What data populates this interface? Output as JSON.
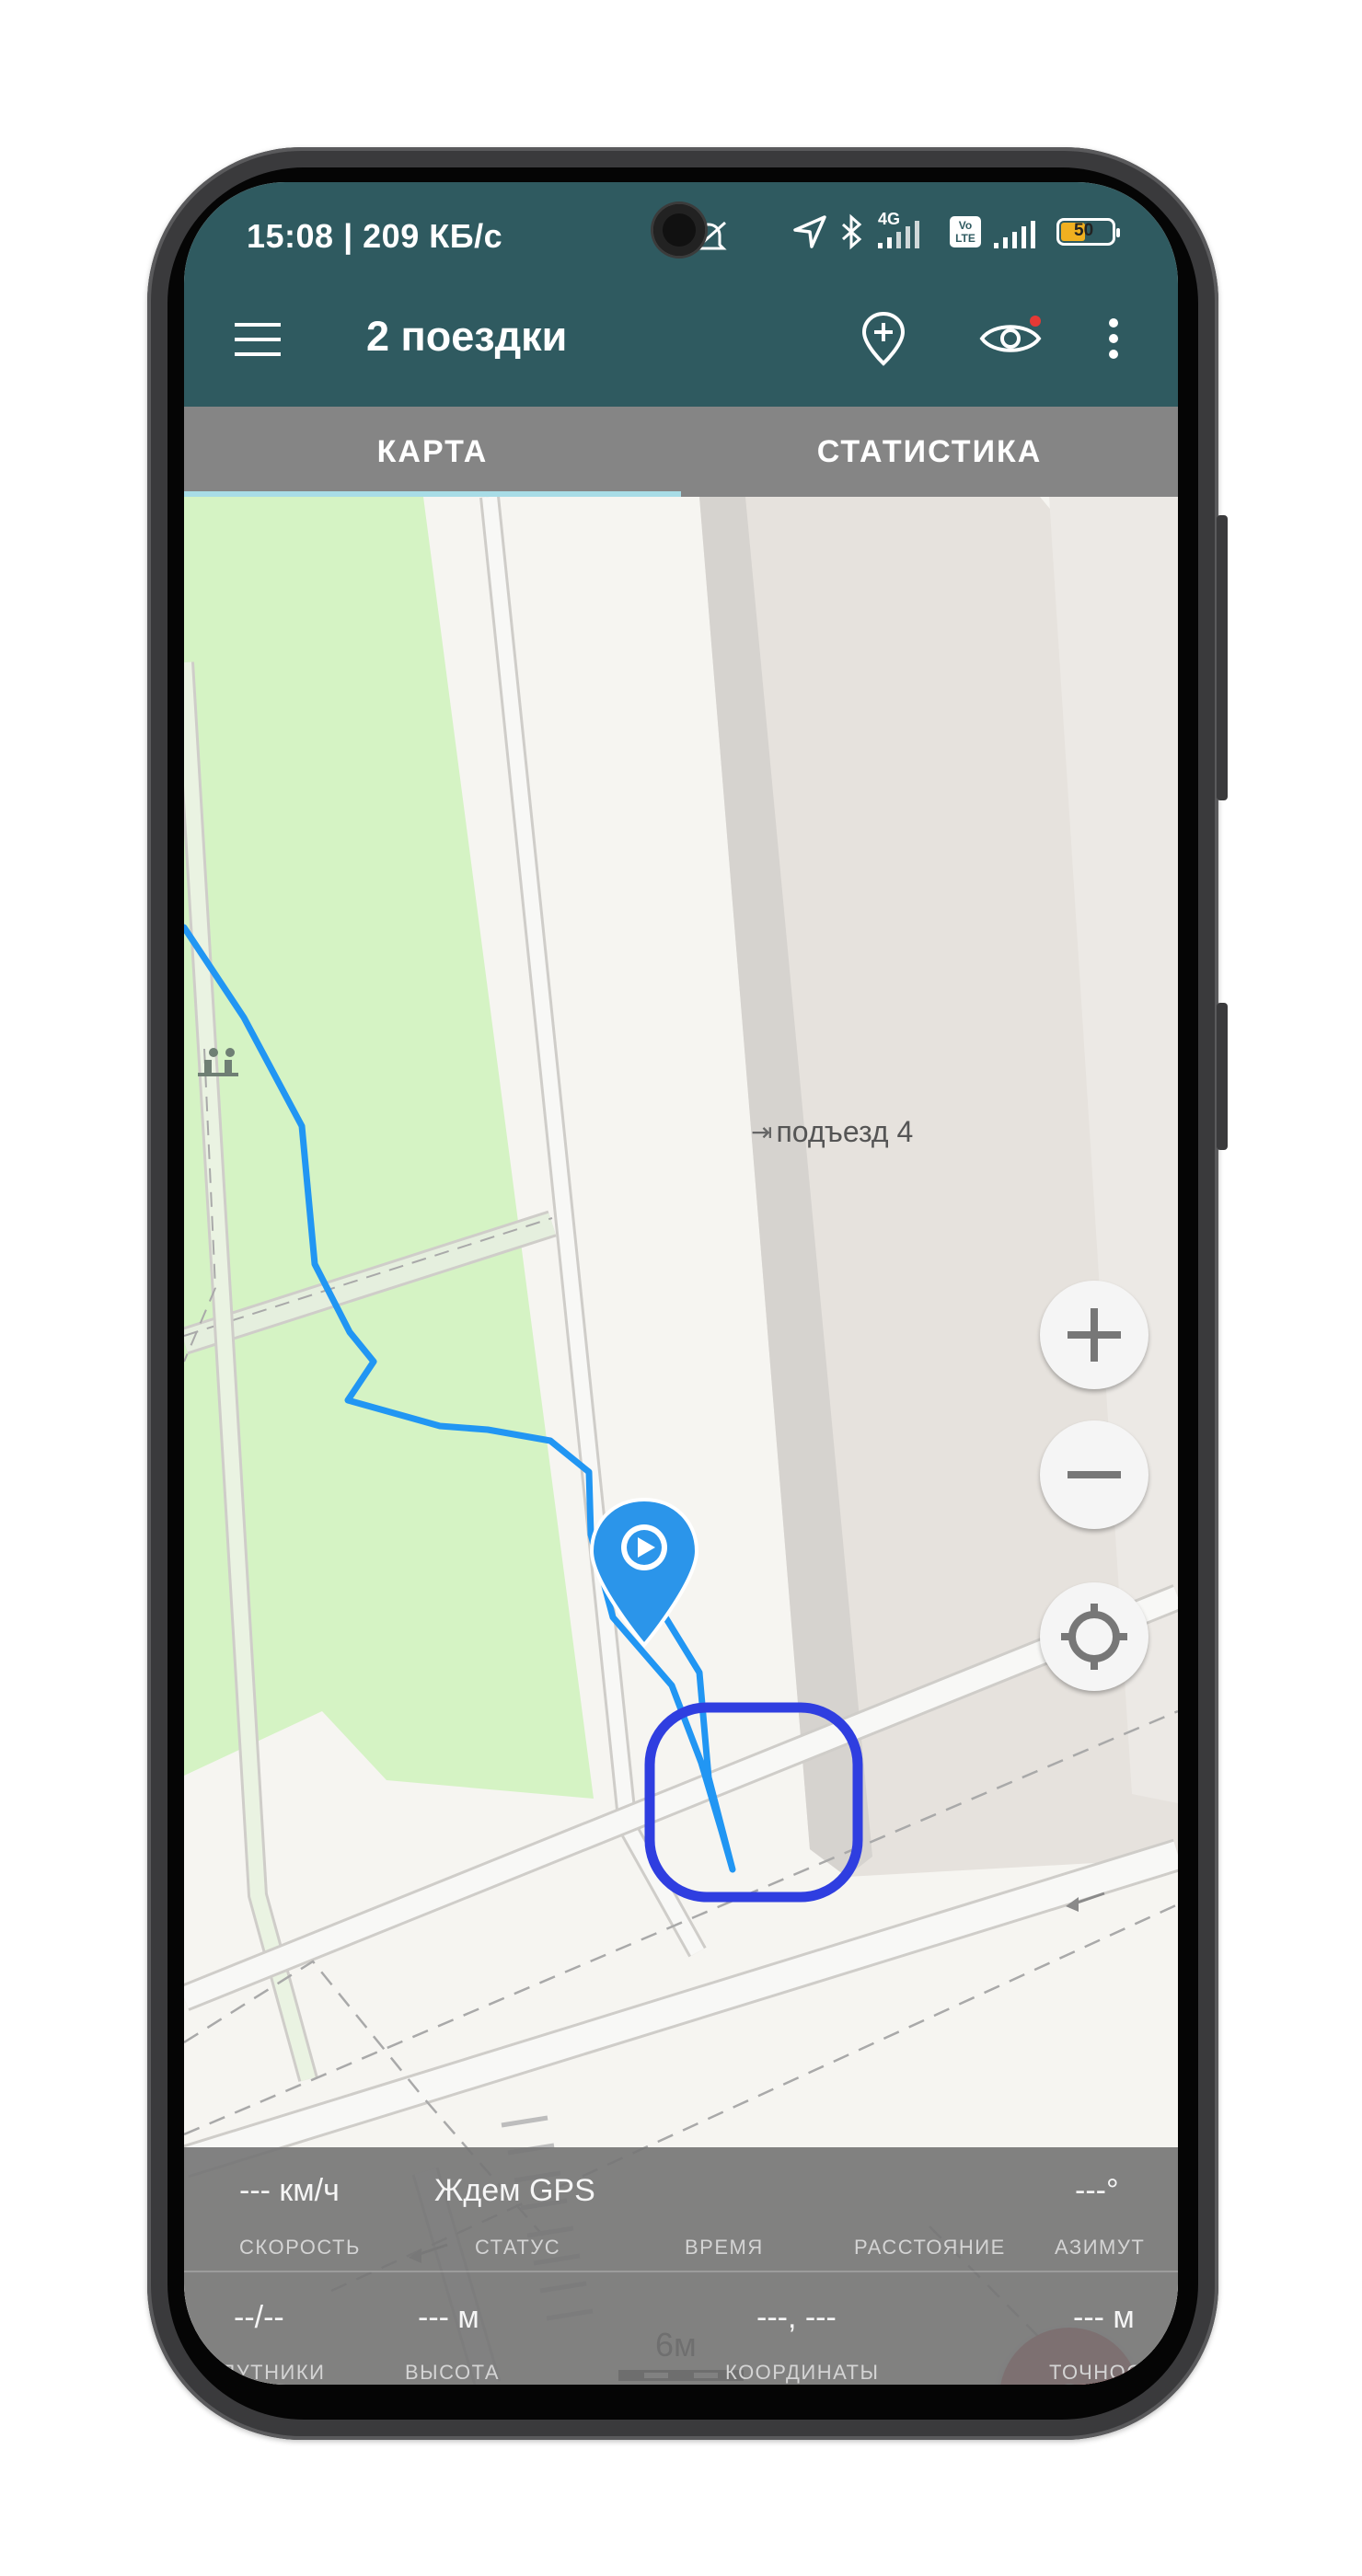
{
  "status_bar": {
    "time": "15:08 | 209 КБ/с",
    "network": "4G",
    "volte": "Vo LTE",
    "battery": "50"
  },
  "app_bar": {
    "title": "2 поездки",
    "icons": [
      "menu-icon",
      "add-marker-icon",
      "eye-icon",
      "more-vert-icon"
    ]
  },
  "tabs": [
    {
      "label": "КАРТА",
      "active": true
    },
    {
      "label": "СТАТИСТИКА",
      "active": false
    }
  ],
  "map": {
    "poi_label": "подъезд 4",
    "scale_label": "6м",
    "accent_track_color": "#2196f3",
    "highlight_color": "#2f3ee0"
  },
  "stats": {
    "speed_value": "--- км/ч",
    "speed_label": "СКОРОСТЬ",
    "status_value": "Ждем GPS",
    "status_label": "СТАТУС",
    "time_label": "ВРЕМЯ",
    "distance_label": "РАССТОЯНИЕ",
    "azimuth_value": "---°",
    "azimuth_label": "АЗИМУТ",
    "satellites_value": "--/--",
    "satellites_label": "СПУТНИКИ",
    "altitude_value": "--- м",
    "altitude_label": "ВЫСОТА",
    "coords_value": "---, ---",
    "coords_label": "КООРДИНАТЫ",
    "accuracy_value": "--- м",
    "accuracy_label": "ТОЧНОСТЬ"
  }
}
